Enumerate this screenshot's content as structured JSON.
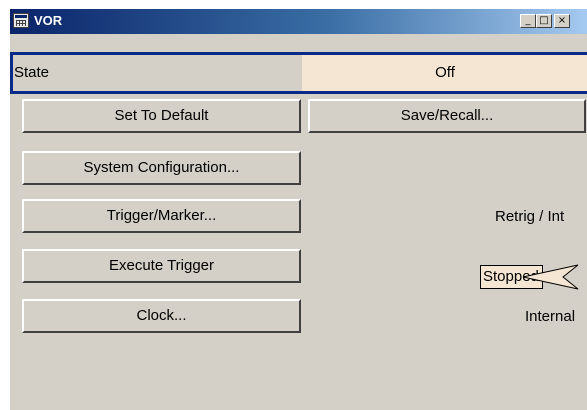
{
  "window": {
    "title": "VOR",
    "minimize_glyph": "_",
    "maximize_glyph": "□",
    "close_glyph": "×"
  },
  "state": {
    "label": "State",
    "value": "Off"
  },
  "buttons": {
    "set_to_default": "Set To Default",
    "save_recall": "Save/Recall...",
    "system_configuration": "System Configuration...",
    "trigger_marker": "Trigger/Marker...",
    "execute_trigger": "Execute Trigger",
    "clock": "Clock..."
  },
  "values": {
    "trigger_mode": "Retrig / Int",
    "trigger_status": "Stopped",
    "clock_source": "Internal"
  },
  "colors": {
    "title_gradient_start": "#0a246a",
    "state_frame": "#0a2a8a",
    "highlight_field": "#f5e6d3",
    "panel_background": "#d4d0c8"
  }
}
